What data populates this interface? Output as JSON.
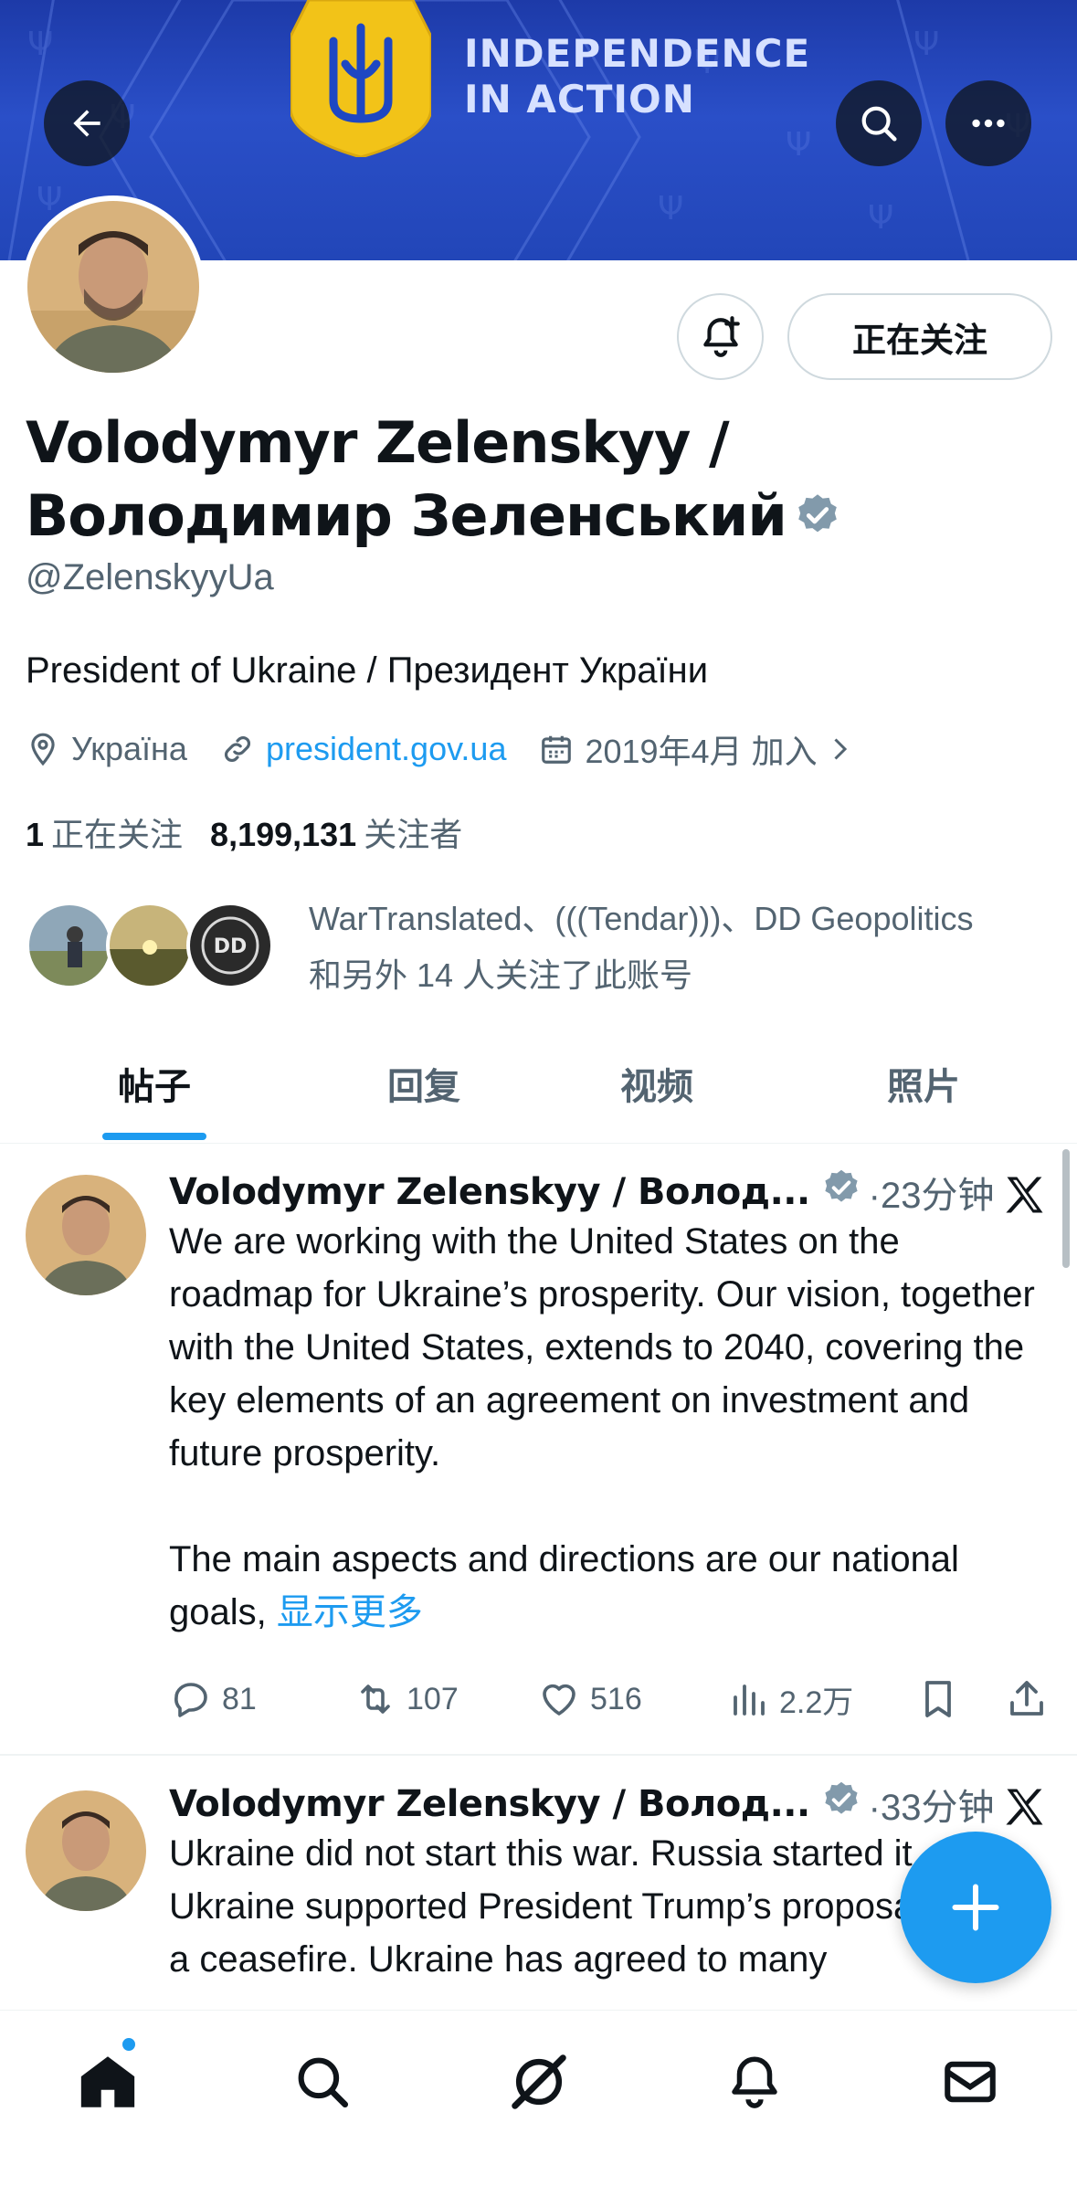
{
  "banner": {
    "text_line1": "INDEPENDENCE",
    "text_line2": "IN ACTION"
  },
  "profile": {
    "display_name": "Volodymyr Zelenskyy / Володимир Зеленський",
    "handle": "@ZelenskyyUa",
    "bio": "President of Ukraine / Президент України",
    "location": "Україна",
    "website": "president.gov.ua",
    "joined": "2019年4月 加入",
    "following_count": "1",
    "following_label": "正在关注",
    "followers_count": "8,199,131",
    "followers_label": "关注者",
    "followed_by_line1": "WarTranslated、(((Tendar)))、DD Geopolitics",
    "followed_by_line2": "和另外 14 人关注了此账号",
    "follow_button": "正在关注",
    "verified": true,
    "mini_avatar_dd": "DD"
  },
  "tabs": [
    {
      "label": "帖子",
      "active": true
    },
    {
      "label": "回复",
      "active": false
    },
    {
      "label": "视频",
      "active": false
    },
    {
      "label": "照片",
      "active": false
    }
  ],
  "posts": [
    {
      "name": "Volodymyr Zelenskyy / Волод...",
      "time": "·23分钟",
      "text": "We are working with the United States on the roadmap for Ukraine’s prosperity. Our vision, together with the United States, extends to 2040, covering the key elements of an agreement on investment and future prosperity.\n\nThe main aspects and directions are our national goals, ",
      "show_more": "显示更多",
      "replies": "81",
      "reposts": "107",
      "likes": "516",
      "views": "2.2万"
    },
    {
      "name": "Volodymyr Zelenskyy / Волод...",
      "time": "·33分钟",
      "text": "Ukraine did not start this war. Russia started it. Ukraine supported President Trump’s proposal for a ceasefire. Ukraine has agreed to many"
    }
  ],
  "colors": {
    "accent": "#1d9bf0",
    "text_primary": "#0f1419",
    "text_secondary": "#536471",
    "banner_blue": "#2246b8",
    "shield_yellow": "#f2c318"
  }
}
